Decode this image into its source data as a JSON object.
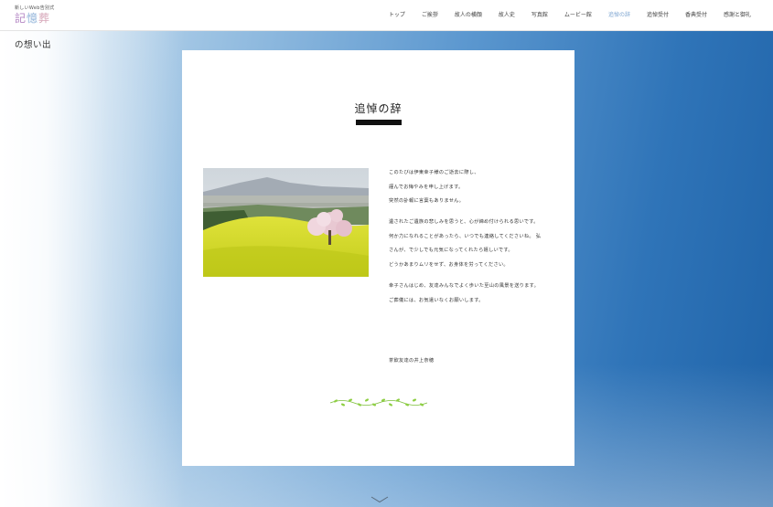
{
  "logo": {
    "subtitle": "新しいWeb告別式",
    "chars": [
      "記",
      "憶",
      "葬"
    ]
  },
  "nav": [
    {
      "label": "トップ"
    },
    {
      "label": "ご挨拶"
    },
    {
      "label": "故人の横顔"
    },
    {
      "label": "故人史"
    },
    {
      "label": "写真館"
    },
    {
      "label": "ムービー館"
    },
    {
      "label": "追悼の辞"
    },
    {
      "label": "追悼受付"
    },
    {
      "label": "香典受付"
    },
    {
      "label": "感謝と御礼"
    }
  ],
  "active_nav": "追悼の辞",
  "page_title": "の想い出",
  "card": {
    "heading": "追悼の辞",
    "paragraphs": [
      [
        "このたびは伊東幸子様のご逝去に際し、",
        "謹んでお悔やみを申し上げます。",
        "突然の訃報に言葉もありません。"
      ],
      [
        "遺されたご遺族の悲しみを思うと、心が締め付けられる思いです。",
        "何か力になれることがあったら、いつでも連絡してくださいね。 弘",
        "さんが、で少しでも元気になってくれたら嬉しいです。",
        "どうかあまりムリをせず、お身体を労ってください。"
      ],
      [
        "幸子さんはじめ、友達みんなでよく歩いた至山の風景を送ります。",
        "ご葬儀には、お気遣いなくお願いします。"
      ]
    ],
    "signature": "茶飲友達の井上奈穂"
  },
  "colors": {
    "accent": "#7fa6d1",
    "sky_dark": "#1f63a8",
    "sky_light": "#d6e6f3"
  },
  "icons": [
    "chevron-down-icon",
    "vine-ornament"
  ]
}
